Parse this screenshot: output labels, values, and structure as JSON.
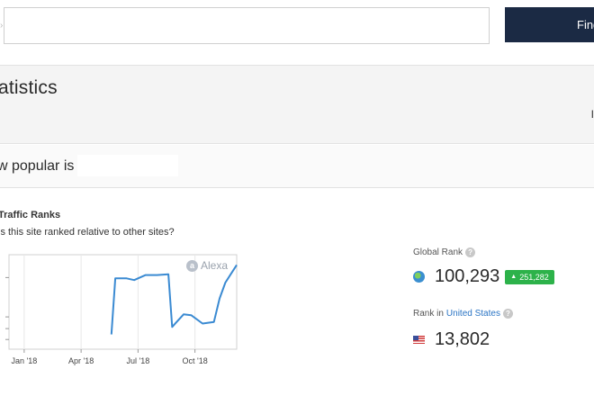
{
  "search": {
    "value": "",
    "placeholder": "",
    "caret": "›",
    "find_label": "Find"
  },
  "stats": {
    "title": "atistics",
    "right_fragment": "I"
  },
  "popular": {
    "text": "w popular is"
  },
  "traffic": {
    "heading": "Traffic Ranks",
    "subheading": "is this site ranked relative to other sites?"
  },
  "alexa": {
    "logo_letter": "a",
    "label": "Alexa"
  },
  "chart_data": {
    "type": "line",
    "title": "",
    "xlabel": "",
    "ylabel": "",
    "x_tick_labels": [
      "Jan '18",
      "Apr '18",
      "Jul '18",
      "Oct '18"
    ],
    "x_tick_months": [
      0,
      3,
      6,
      9
    ],
    "x_range_months": [
      -0.8,
      11.2
    ],
    "y_ticks": [
      "",
      "",
      ""
    ],
    "grid": true,
    "series": [
      {
        "name": "",
        "points": [
          [
            4.6,
            0.09
          ],
          [
            4.8,
            0.76
          ],
          [
            5.4,
            0.76
          ],
          [
            5.8,
            0.74
          ],
          [
            6.4,
            0.8
          ],
          [
            7.0,
            0.8
          ],
          [
            7.6,
            0.81
          ],
          [
            7.8,
            0.18
          ],
          [
            8.0,
            0.23
          ],
          [
            8.4,
            0.33
          ],
          [
            8.8,
            0.32
          ],
          [
            9.4,
            0.22
          ],
          [
            10.0,
            0.24
          ],
          [
            10.3,
            0.52
          ],
          [
            10.6,
            0.71
          ],
          [
            11.2,
            0.92
          ]
        ]
      }
    ],
    "note_y_normalized_rank_higher_is_better": true
  },
  "global_rank": {
    "label": "Global Rank",
    "value": "100,293",
    "delta": "251,282",
    "icon": "globe-icon"
  },
  "country_rank": {
    "label_prefix": "Rank in",
    "country": "United States",
    "value": "13,802",
    "icon": "us-flag-icon"
  },
  "colors": {
    "accent": "#1b2a44",
    "line": "#3a8ad2",
    "delta_green": "#2db24a",
    "link": "#2a74c4"
  }
}
